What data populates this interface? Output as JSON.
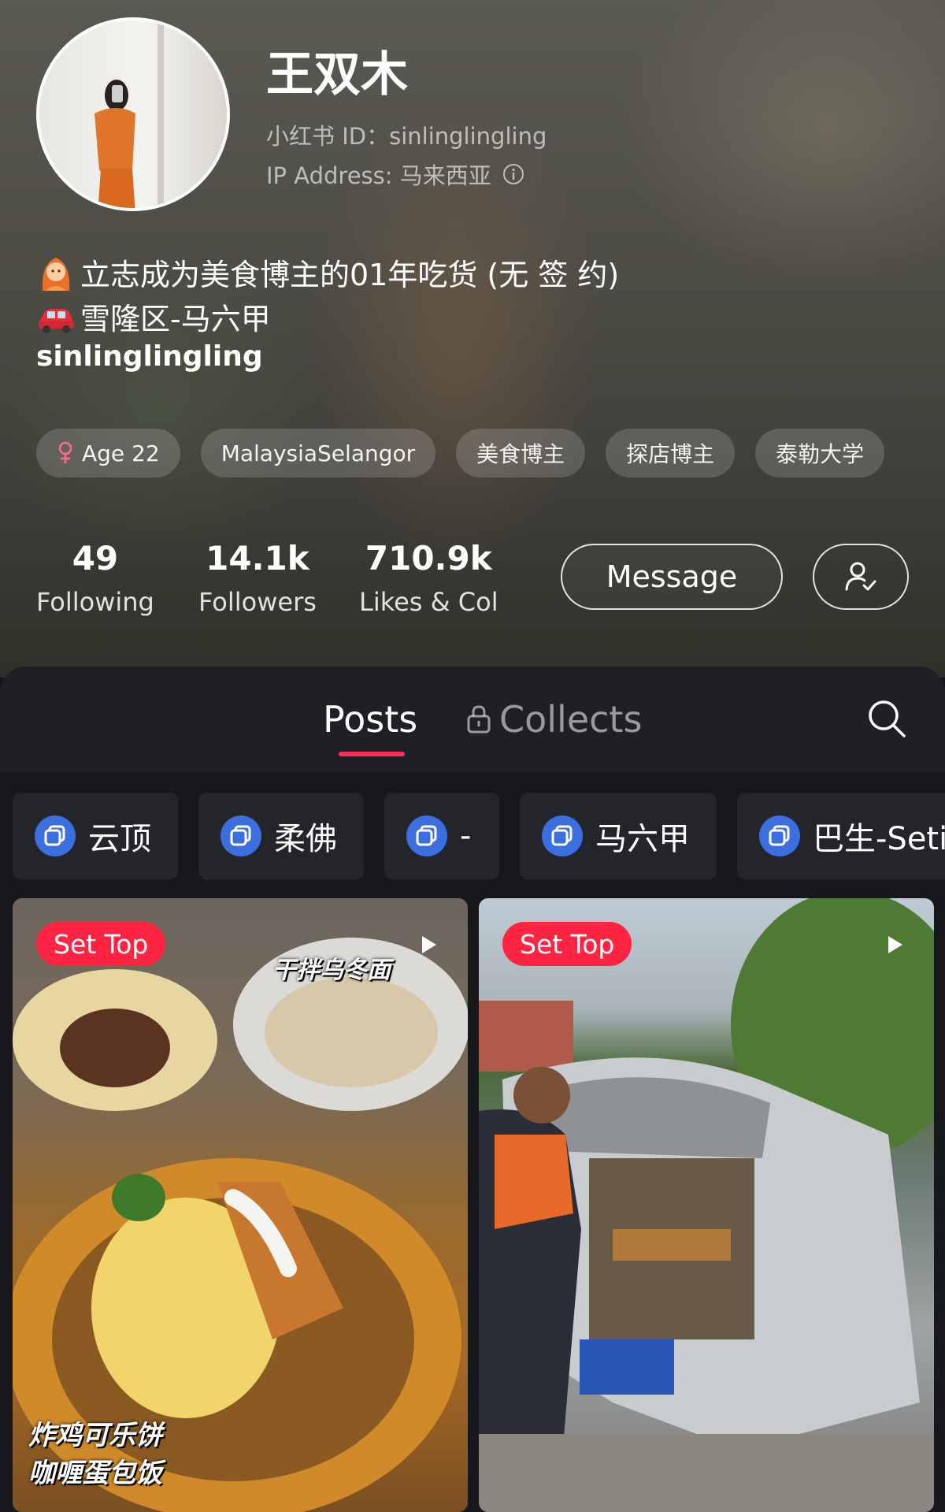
{
  "profile": {
    "nickname": "王双木",
    "id_line": "小红书 ID：sinlinglingling",
    "ip_line": "IP Address: 马来西亚",
    "bio_line1": "立志成为美食博主的01年吃货 (无 签 约)",
    "bio_line2": "雪隆区-马六甲",
    "handle": "sinlinglingling",
    "tags": [
      "Age 22",
      "MalaysiaSelangor",
      "美食博主",
      "探店博主",
      "泰勒大学"
    ]
  },
  "stats": [
    {
      "value": "49",
      "label": "Following"
    },
    {
      "value": "14.1k",
      "label": "Followers"
    },
    {
      "value": "710.9k",
      "label": "Likes & Col"
    }
  ],
  "actions": {
    "message_label": "Message"
  },
  "tabs": {
    "posts": "Posts",
    "collects": "Collects"
  },
  "albums": [
    "云顶",
    "柔佛",
    "-",
    "马六甲",
    "巴生-Seti"
  ],
  "posts": [
    {
      "badge": "Set Top",
      "caption_top": "干拌乌冬面",
      "caption_bottom_1": "炸鸡可乐饼",
      "caption_bottom_2": "咖喱蛋包饭"
    },
    {
      "badge": "Set Top"
    }
  ],
  "colors": {
    "accent": "#ff2442",
    "underline": "#ff2d55",
    "panel": "#17181c"
  },
  "icons": [
    "female-icon",
    "info-icon",
    "follow-user-icon",
    "lock-icon",
    "search-icon",
    "album-icon",
    "play-icon"
  ]
}
